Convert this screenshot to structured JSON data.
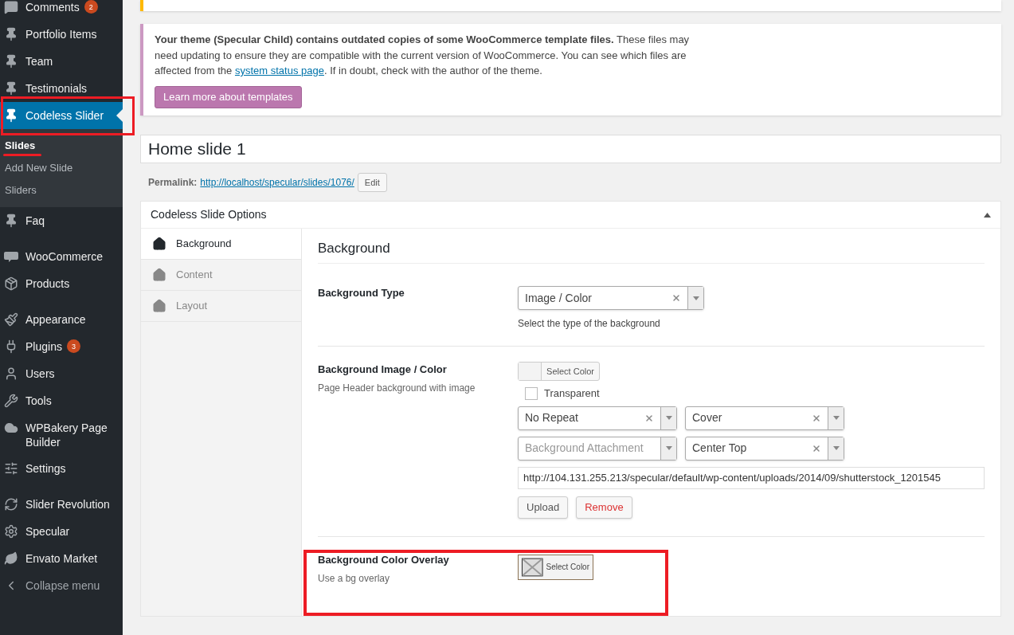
{
  "sidebar": {
    "groups": [
      [
        {
          "label": "Comments",
          "badge": "2",
          "selected": false
        },
        {
          "label": "Portfolio Items",
          "selected": false
        },
        {
          "label": "Team",
          "selected": false
        },
        {
          "label": "Testimonials",
          "selected": false
        },
        {
          "label": "Codeless Slider",
          "selected": true,
          "children": [
            {
              "label": "Slides",
              "selected": true
            },
            {
              "label": "Add New Slide",
              "selected": false
            },
            {
              "label": "Sliders",
              "selected": false
            }
          ]
        },
        {
          "label": "Faq",
          "selected": false
        }
      ],
      [
        {
          "label": "WooCommerce",
          "selected": false
        },
        {
          "label": "Products",
          "selected": false
        }
      ],
      [
        {
          "label": "Appearance",
          "selected": false
        },
        {
          "label": "Plugins",
          "badge": "3",
          "selected": false
        },
        {
          "label": "Users",
          "selected": false
        },
        {
          "label": "Tools",
          "selected": false
        },
        {
          "label": "WPBakery Page Builder",
          "selected": false
        },
        {
          "label": "Settings",
          "selected": false
        }
      ],
      [
        {
          "label": "Slider Revolution",
          "selected": false
        },
        {
          "label": "Specular",
          "selected": false
        },
        {
          "label": "Envato Market",
          "selected": false
        },
        {
          "label": "Collapse menu",
          "selected": false
        }
      ]
    ]
  },
  "notice": {
    "bold": "Your theme (Specular Child) contains outdated copies of some WooCommerce template files.",
    "text_before_link": "These files may need updating to ensure they are compatible with the current version of WooCommerce. You can see which files are affected from the",
    "link": "system status page",
    "text_after_link": ". If in doubt, check with the author of the theme.",
    "button": "Learn more about templates"
  },
  "post_title": "Home slide 1",
  "permalink": {
    "label": "Permalink:",
    "url": "http://localhost/specular/slides/1076/",
    "button": "Edit"
  },
  "metabox": {
    "title": "Codeless Slide Options",
    "expanded": true,
    "tabs": [
      {
        "label": "Background",
        "selected": true
      },
      {
        "label": "Content",
        "selected": false
      },
      {
        "label": "Layout",
        "selected": false
      }
    ],
    "section_title": "Background",
    "fields": [
      {
        "kind": "select",
        "label": "Background Type",
        "value": "Image / Color",
        "help": "Select the type of the background"
      },
      {
        "kind": "image",
        "label": "Background Image / Color",
        "description": "Page Header background with image",
        "color_button": "Select Color",
        "transparent": {
          "label": "Transparent",
          "checked": false
        },
        "selects": [
          {
            "value": "No Repeat",
            "placeholder": false
          },
          {
            "value": "Cover",
            "placeholder": false
          },
          {
            "value": "Background Attachment",
            "placeholder": true
          },
          {
            "value": "Center Top",
            "placeholder": false
          }
        ],
        "url": "http://104.131.255.213/specular/default/wp-content/uploads/2014/09/shutterstock_1201545",
        "upload": "Upload",
        "remove": "Remove"
      },
      {
        "kind": "color",
        "label": "Background Color Overlay",
        "description": "Use a bg overlay",
        "color_button": "Select Color"
      }
    ]
  }
}
